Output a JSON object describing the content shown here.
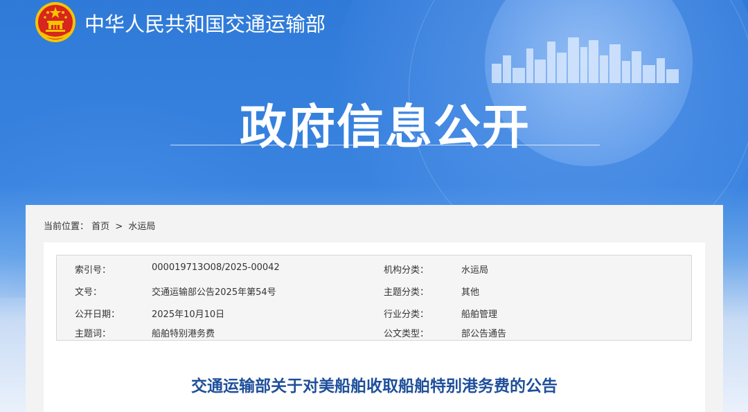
{
  "header": {
    "ministry_name": "中华人民共和国交通运输部",
    "section_title": "政府信息公开"
  },
  "breadcrumb": {
    "prefix": "当前位置：",
    "items": [
      "首页",
      "水运局"
    ],
    "separator": ">"
  },
  "metadata": {
    "rows": [
      {
        "label1": "索引号：",
        "value1": "000019713O08/2025-00042",
        "label2": "机构分类：",
        "value2": "水运局"
      },
      {
        "label1": "文号：",
        "value1": "交通运输部公告2025年第54号",
        "label2": "主题分类：",
        "value2": "其他"
      },
      {
        "label1": "公开日期：",
        "value1": "2025年10月10日",
        "label2": "行业分类：",
        "value2": "船舶管理"
      },
      {
        "label1": "主题词：",
        "value1": "船舶特别港务费",
        "label2": "公文类型：",
        "value2": "部公告通告"
      }
    ]
  },
  "document": {
    "title": "交通运输部关于对美船舶收取船舶特别港务费的公告"
  },
  "colors": {
    "banner_blue": "#2f7ad8",
    "title_blue": "#1f4f9a",
    "emblem_red": "#d7261e",
    "emblem_gold": "#f5c400"
  },
  "icons": {
    "emblem": "national-emblem-icon",
    "skyline": "city-skyline-decoration"
  }
}
